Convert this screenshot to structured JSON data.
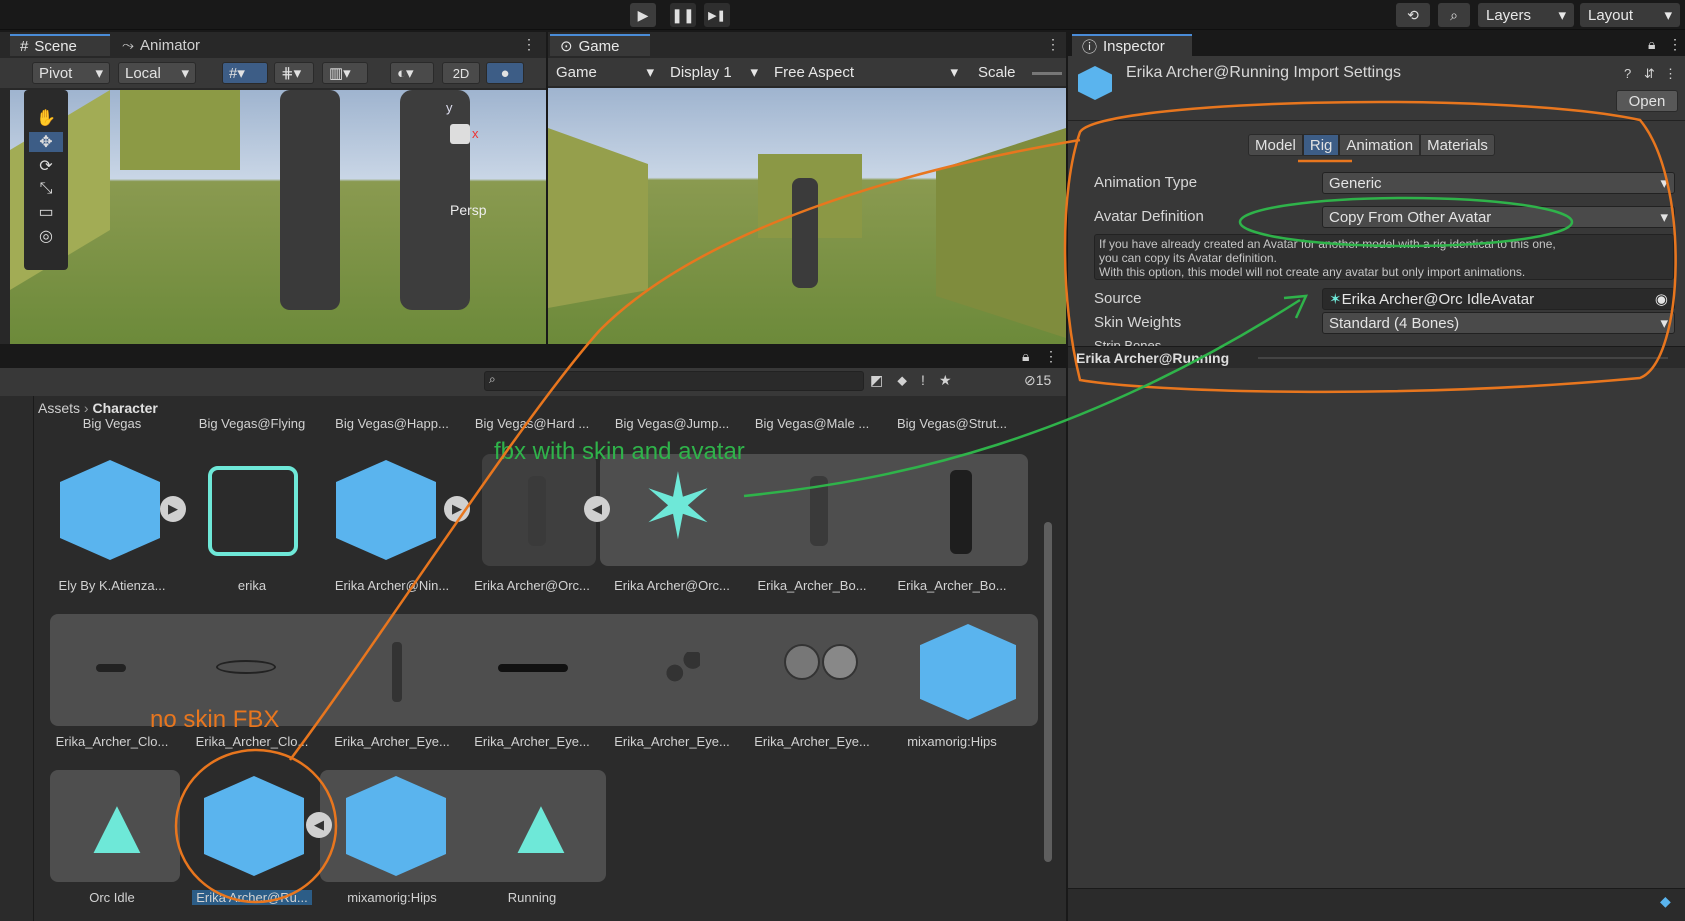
{
  "toolbar": {
    "layers": "Layers",
    "layout": "Layout",
    "play": "▶",
    "pause": "❚❚",
    "step": "▶❚"
  },
  "scene_panel": {
    "tabs": [
      "Scene",
      "Animator"
    ],
    "pivot": "Pivot",
    "local": "Local",
    "mode2d": "2D",
    "persp": "Persp",
    "axis_x": "x",
    "axis_y": "y"
  },
  "game_panel": {
    "tab": "Game",
    "game_drop": "Game",
    "display": "Display 1",
    "aspect": "Free Aspect",
    "scale": "Scale"
  },
  "inspector": {
    "tab": "Inspector",
    "title": "Erika Archer@Running Import Settings",
    "open": "Open",
    "tabs": [
      "Model",
      "Rig",
      "Animation",
      "Materials"
    ],
    "animation_type_label": "Animation Type",
    "animation_type": "Generic",
    "avatar_def_label": "Avatar Definition",
    "avatar_def": "Copy From Other Avatar",
    "help_lines": [
      "If you have already created an Avatar for another model with a rig identical to this one,",
      "you can copy its Avatar definition.",
      "With this option, this model will not create any avatar but only import animations."
    ],
    "source_label": "Source",
    "source": "Erika Archer@Orc IdleAvatar",
    "skin_label": "Skin Weights",
    "skin": "Standard (4 Bones)",
    "strip_label": "Strip Bones",
    "preview_title": "Erika Archer@Running"
  },
  "project": {
    "breadcrumb_root": "Assets",
    "breadcrumb_current": "Character",
    "hidden_count": "15",
    "row0": [
      "Big Vegas",
      "Big Vegas@Flying",
      "Big Vegas@Happ...",
      "Big Vegas@Hard ...",
      "Big Vegas@Jump...",
      "Big Vegas@Male ...",
      "Big Vegas@Strut..."
    ],
    "row1": [
      "Ely By K.Atienza...",
      "erika",
      "Erika Archer@Nin...",
      "Erika Archer@Orc...",
      "Erika Archer@Orc...",
      "Erika_Archer_Bo...",
      "Erika_Archer_Bo..."
    ],
    "row2": [
      "Erika_Archer_Clo...",
      "Erika_Archer_Clo...",
      "Erika_Archer_Eye...",
      "Erika_Archer_Eye...",
      "Erika_Archer_Eye...",
      "Erika_Archer_Eye...",
      "mixamorig:Hips"
    ],
    "row3": [
      "Orc Idle",
      "Erika Archer@Ru...",
      "mixamorig:Hips",
      "Running"
    ]
  },
  "annotations": {
    "fbx_skin": "fbx with skin and avatar",
    "no_skin": "no skin FBX"
  },
  "colors": {
    "orange": "#e8761e",
    "green": "#2fb34a",
    "accent_blue": "#4a8cd8",
    "cube_blue": "#5ab4ee",
    "teal": "#6ee8d8"
  }
}
